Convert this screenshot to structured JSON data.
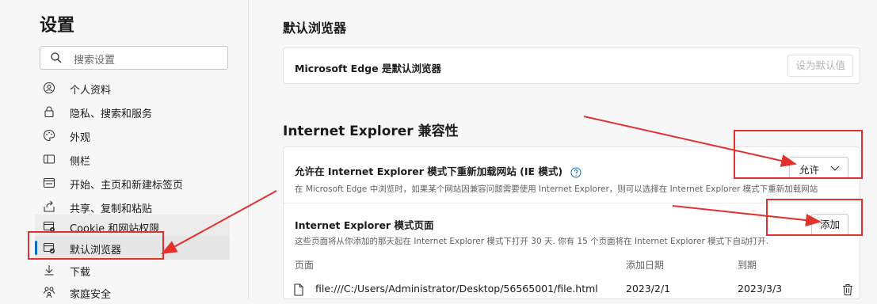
{
  "sidebar": {
    "title": "设置",
    "search_placeholder": "搜索设置",
    "items": [
      {
        "label": "个人资料",
        "icon": "profile-icon"
      },
      {
        "label": "隐私、搜索和服务",
        "icon": "lock-icon"
      },
      {
        "label": "外观",
        "icon": "appearance-icon"
      },
      {
        "label": "侧栏",
        "icon": "sidebar-icon"
      },
      {
        "label": "开始、主页和新建标签页",
        "icon": "home-tab-icon"
      },
      {
        "label": "共享、复制和粘贴",
        "icon": "share-icon"
      },
      {
        "label": "Cookie 和网站权限",
        "icon": "site-permissions-icon"
      },
      {
        "label": "默认浏览器",
        "icon": "default-browser-icon"
      },
      {
        "label": "下载",
        "icon": "download-icon"
      },
      {
        "label": "家庭安全",
        "icon": "family-icon"
      }
    ]
  },
  "main": {
    "default_browser_heading": "默认浏览器",
    "default_browser_status": "Microsoft Edge 是默认浏览器",
    "set_default_label": "设为默认值",
    "ie_heading": "Internet Explorer 兼容性",
    "ie_reload_title": "允许在 Internet Explorer 模式下重新加载网站 (IE 模式)",
    "ie_reload_desc": "在 Microsoft Edge 中浏览时，如果某个网站因兼容问题需要使用 Internet Explorer，则可以选择在 Internet Explorer 模式下重新加载网站",
    "ie_reload_value": "允许",
    "ie_pages_title": "Internet Explorer 模式页面",
    "ie_pages_desc": "这些页面将从你添加的那天起在 Internet Explorer 模式下打开 30 天. 你有 15 个页面将在 Internet Explorer 模式下自动打开.",
    "add_label": "添加",
    "table": {
      "headers": [
        "页面",
        "添加日期",
        "到期"
      ],
      "rows": [
        {
          "page": "file:///C:/Users/Administrator/Desktop/56565001/file.html",
          "added": "2023/2/1",
          "expires": "2023/3/3"
        }
      ]
    }
  },
  "colors": {
    "accent": "#0f6cbd",
    "annotation": "#e3312e"
  }
}
